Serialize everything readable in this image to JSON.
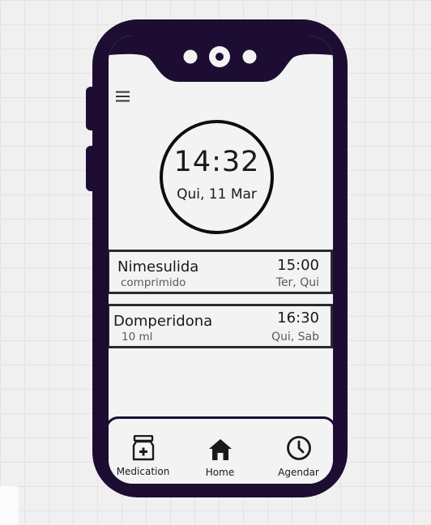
{
  "status": {
    "time": "14:32",
    "date": "Qui, 11 Mar"
  },
  "menu": {
    "icon": "hamburger-menu-icon"
  },
  "medications": [
    {
      "name": "Nimesulida",
      "dose": "comprimido",
      "time": "15:00",
      "days": "Ter, Qui"
    },
    {
      "name": "Domperidona",
      "dose": "10 ml",
      "time": "16:30",
      "days": "Qui, Sab"
    }
  ],
  "nav": {
    "items": [
      {
        "label": "Medication",
        "icon": "medicine-bottle-icon"
      },
      {
        "label": "Home",
        "icon": "home-icon"
      },
      {
        "label": "Agendar",
        "icon": "clock-icon"
      }
    ]
  },
  "colors": {
    "phone_frame": "#1d0d33",
    "screen_bg": "#f3f3f3",
    "canvas_bg": "#f0f0f0"
  }
}
